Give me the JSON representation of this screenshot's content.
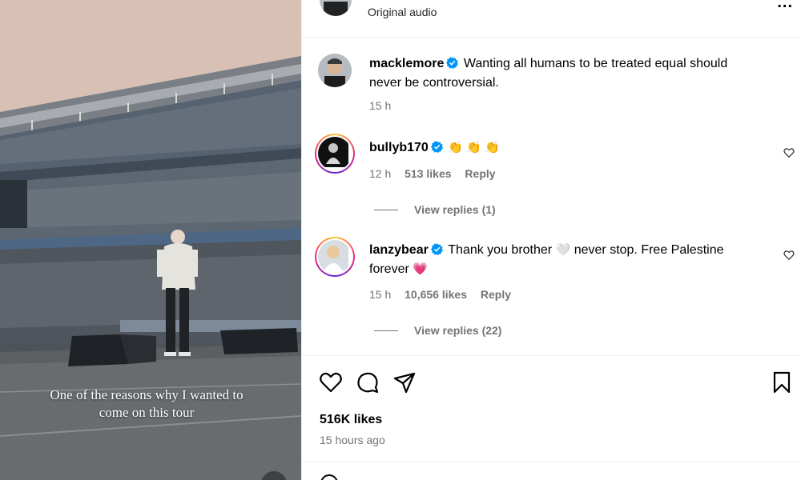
{
  "media": {
    "caption_line1": "One of the reasons why I wanted to",
    "caption_line2": "come on this tour"
  },
  "header": {
    "audio_label": "Original audio",
    "more_glyph": "..."
  },
  "post": {
    "username": "macklemore",
    "text_line1": "Wanting all humans to be treated equal should",
    "text_line2": "never be controversial.",
    "time": "15 h"
  },
  "comments": [
    {
      "username": "bullyb170",
      "text": "",
      "emoji": "👏 👏 👏",
      "time": "12 h",
      "likes": "513 likes",
      "reply": "Reply",
      "view_replies": "View replies (1)"
    },
    {
      "username": "lanzybear",
      "text_line1": "Thank you brother",
      "emoji1": "🤍",
      "text_line1b": "never stop. Free Palestine",
      "text_line2": "forever",
      "emoji2": "💗",
      "time": "15 h",
      "likes": "10,656 likes",
      "reply": "Reply",
      "view_replies": "View replies (22)"
    }
  ],
  "footer": {
    "likes": "516K likes",
    "time_ago": "15 hours ago"
  },
  "colors": {
    "verified": "#0095f6",
    "secondary_text": "#737373"
  },
  "icons": [
    "heart-icon",
    "comment-icon",
    "share-icon",
    "bookmark-icon",
    "verified-icon",
    "more-icon"
  ]
}
